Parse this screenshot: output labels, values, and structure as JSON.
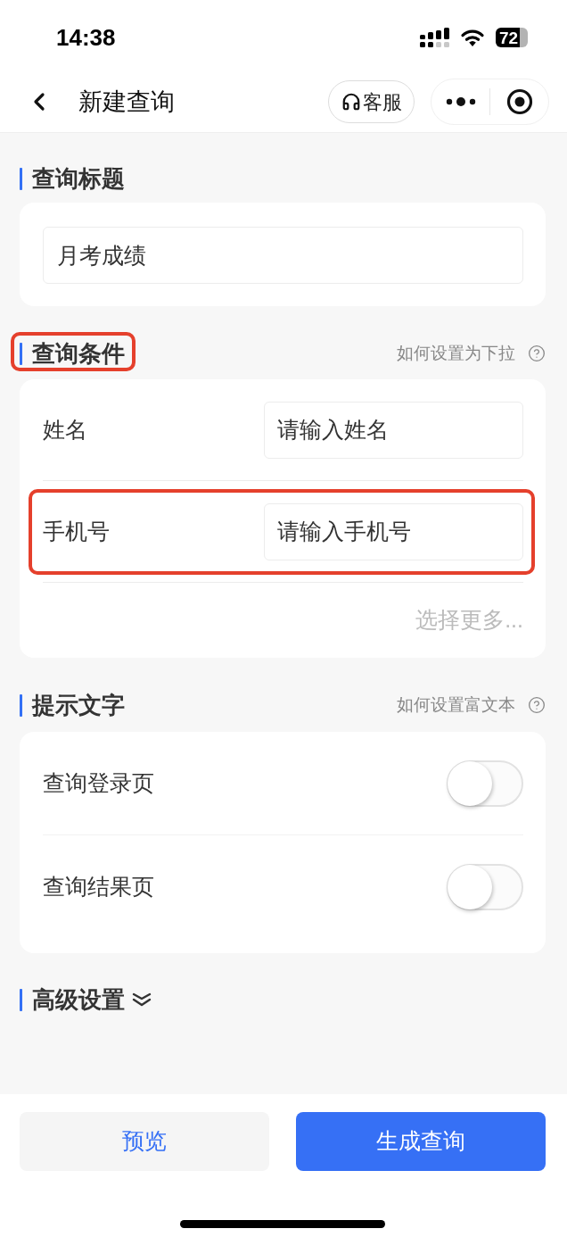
{
  "status_bar": {
    "time": "14:38",
    "battery": "72"
  },
  "nav_bar": {
    "title": "新建查询",
    "service_button": "客服"
  },
  "sections": [
    {
      "kind": "title",
      "heading": "查询标题",
      "highlighted": false,
      "value": "月考成绩"
    },
    {
      "kind": "conditions",
      "heading": "查询条件",
      "highlighted": true,
      "help": "如何设置为下拉",
      "fields": [
        {
          "label": "姓名",
          "placeholder": "请输入姓名",
          "highlighted": false
        },
        {
          "label": "手机号",
          "placeholder": "请输入手机号",
          "highlighted": true
        }
      ],
      "more": "选择更多..."
    },
    {
      "kind": "toggles",
      "heading": "提示文字",
      "highlighted": false,
      "help": "如何设置富文本",
      "toggles": [
        {
          "label": "查询登录页",
          "on": false
        },
        {
          "label": "查询结果页",
          "on": false
        }
      ]
    },
    {
      "kind": "collapsed",
      "heading": "高级设置",
      "highlighted": false,
      "expanded": false
    }
  ],
  "footer": {
    "buttons": [
      {
        "label": "预览",
        "kind": "secondary"
      },
      {
        "label": "生成查询",
        "kind": "primary"
      }
    ]
  }
}
